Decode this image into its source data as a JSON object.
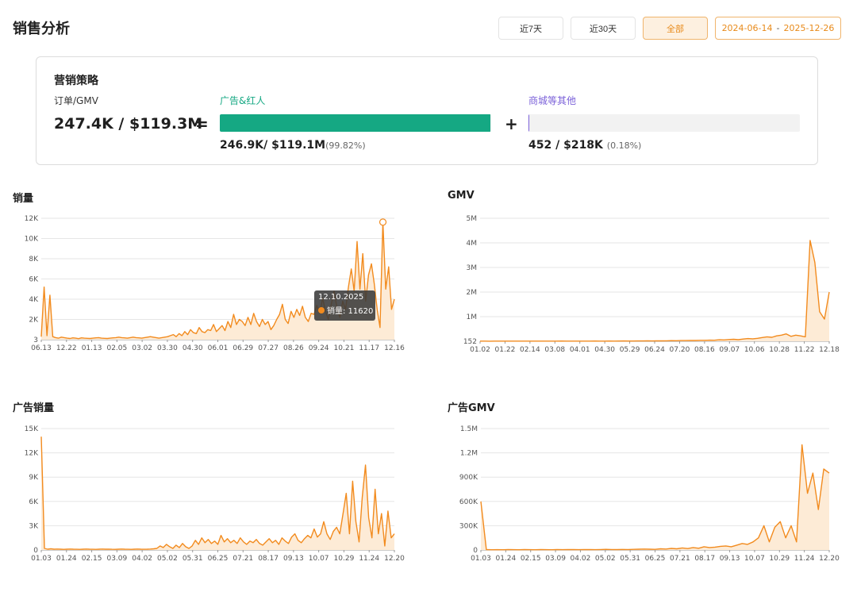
{
  "page": {
    "title": "销售分析"
  },
  "filters": {
    "btn7": "近7天",
    "btn30": "近30天",
    "all": "全部",
    "date_start": "2024-06-14",
    "date_sep": "-",
    "date_end": "2025-12-26"
  },
  "strategy": {
    "title": "营销策略",
    "label": "订单/GMV",
    "total": "247.4K / $119.3M",
    "equals": "=",
    "plus": "+",
    "ad": {
      "label": "广告&红人",
      "value": "246.9K/ $119.1M",
      "pct": "(99.82%)",
      "share": 99.82,
      "color": "#15a883"
    },
    "other": {
      "label": "商城等其他",
      "value": "452 / $218K",
      "pct": "(0.18%)",
      "share": 0.18,
      "color": "#7b61d9"
    }
  },
  "colors": {
    "line": "#f28b1e",
    "area": "#fdebd6",
    "grid": "#e6e6e6",
    "axis": "#555555"
  },
  "charts": {
    "sales": {
      "title": "销量"
    },
    "gmv": {
      "title": "GMV"
    },
    "ad_sales": {
      "title": "广告销量"
    },
    "ad_gmv": {
      "title": "广告GMV"
    }
  },
  "tooltip": {
    "date": "12.10.2025",
    "label": "销量: 11620"
  },
  "chart_data": [
    {
      "type": "area",
      "title": "销量",
      "x_ticks": [
        "06.13",
        "12.22",
        "01.13",
        "02.05",
        "03.02",
        "03.30",
        "04.30",
        "06.01",
        "06.29",
        "07.27",
        "08.26",
        "09.24",
        "10.21",
        "11.17",
        "12.16"
      ],
      "y_ticks": [
        "3",
        "2K",
        "4K",
        "6K",
        "8K",
        "10K",
        "12K"
      ],
      "ylim": [
        0,
        12000
      ],
      "values": [
        300,
        5200,
        400,
        4400,
        300,
        200,
        150,
        250,
        200,
        150,
        120,
        180,
        150,
        100,
        180,
        150,
        130,
        120,
        150,
        180,
        200,
        150,
        130,
        120,
        150,
        180,
        200,
        250,
        200,
        180,
        150,
        200,
        250,
        200,
        180,
        150,
        200,
        250,
        300,
        250,
        200,
        150,
        200,
        250,
        300,
        400,
        500,
        300,
        600,
        400,
        800,
        500,
        1000,
        700,
        600,
        1200,
        800,
        700,
        1000,
        900,
        1500,
        800,
        1100,
        1400,
        900,
        1800,
        1200,
        2500,
        1500,
        2000,
        1800,
        1400,
        2200,
        1500,
        2600,
        1800,
        1300,
        2000,
        1500,
        1800,
        1000,
        1400,
        2000,
        2500,
        3500,
        2000,
        1600,
        2800,
        2200,
        3000,
        2400,
        3300,
        2200,
        1800,
        2600,
        2500,
        3400,
        2600,
        4100,
        2800,
        2000,
        3500,
        4800,
        3200,
        2200,
        3800,
        3000,
        5200,
        7000,
        4800,
        9700,
        5000,
        8500,
        3800,
        6400,
        7500,
        5500,
        3000,
        1200,
        11620,
        5000,
        7200,
        3000,
        4000
      ],
      "marker_index": 119
    },
    {
      "type": "area",
      "title": "GMV",
      "x_ticks": [
        "01.02",
        "01.22",
        "02.14",
        "03.08",
        "04.01",
        "04.30",
        "05.29",
        "06.24",
        "07.20",
        "08.16",
        "09.07",
        "10.06",
        "10.28",
        "11.22",
        "12.18"
      ],
      "y_ticks": [
        "152",
        "1M",
        "2M",
        "3M",
        "4M",
        "5M"
      ],
      "ylim": [
        0,
        5000000
      ],
      "values": [
        5000,
        6000,
        4000,
        5000,
        6000,
        7000,
        5000,
        8000,
        6000,
        5000,
        7000,
        6000,
        5000,
        8000,
        7000,
        6000,
        5000,
        9000,
        7000,
        6000,
        8000,
        5000,
        7000,
        6000,
        9000,
        8000,
        7000,
        10000,
        8000,
        9000,
        12000,
        10000,
        9000,
        14000,
        12000,
        15000,
        13000,
        18000,
        16000,
        20000,
        25000,
        22000,
        30000,
        28000,
        35000,
        32000,
        40000,
        38000,
        45000,
        42000,
        60000,
        55000,
        70000,
        80000,
        65000,
        90000,
        110000,
        100000,
        120000,
        150000,
        180000,
        160000,
        220000,
        250000,
        300000,
        200000,
        250000,
        220000,
        180000,
        4100000,
        3200000,
        1200000,
        900000,
        2000000
      ]
    },
    {
      "type": "area",
      "title": "广告销量",
      "x_ticks": [
        "01.03",
        "01.24",
        "02.15",
        "03.09",
        "04.02",
        "05.02",
        "05.31",
        "06.25",
        "07.21",
        "08.17",
        "09.13",
        "10.07",
        "10.29",
        "11.24",
        "12.20"
      ],
      "y_ticks": [
        "0",
        "3K",
        "6K",
        "9K",
        "12K",
        "15K"
      ],
      "ylim": [
        0,
        15000
      ],
      "values": [
        14000,
        200,
        100,
        150,
        100,
        120,
        100,
        80,
        100,
        120,
        100,
        90,
        80,
        100,
        120,
        100,
        90,
        80,
        100,
        120,
        100,
        110,
        90,
        80,
        100,
        120,
        100,
        90,
        80,
        100,
        120,
        100,
        90,
        100,
        120,
        150,
        200,
        500,
        300,
        700,
        400,
        200,
        600,
        300,
        800,
        400,
        200,
        500,
        1200,
        700,
        1500,
        900,
        1300,
        800,
        1100,
        700,
        1800,
        1000,
        1400,
        900,
        1200,
        800,
        1500,
        1000,
        700,
        1100,
        900,
        1300,
        800,
        600,
        1000,
        1400,
        900,
        1200,
        700,
        1500,
        1100,
        800,
        1600,
        2000,
        1200,
        900,
        1400,
        1800,
        1500,
        2600,
        1600,
        2000,
        3500,
        2000,
        1300,
        2300,
        2800,
        2000,
        4500,
        7000,
        2000,
        8500,
        3500,
        1000,
        6500,
        10500,
        4000,
        1500,
        7500,
        2000,
        4500,
        500,
        4800,
        1500,
        2000
      ]
    },
    {
      "type": "area",
      "title": "广告GMV",
      "x_ticks": [
        "01.03",
        "01.24",
        "02.15",
        "03.09",
        "04.02",
        "05.02",
        "05.31",
        "06.25",
        "07.21",
        "08.17",
        "09.13",
        "10.07",
        "10.29",
        "11.24",
        "12.20"
      ],
      "y_ticks": [
        "0",
        "300K",
        "600K",
        "900K",
        "1.2M",
        "1.5M"
      ],
      "ylim": [
        0,
        1500000
      ],
      "values": [
        600000,
        5000,
        3000,
        4000,
        3000,
        5000,
        4000,
        3000,
        5000,
        4000,
        3000,
        5000,
        4000,
        3000,
        5000,
        4000,
        6000,
        5000,
        4000,
        6000,
        5000,
        4000,
        6000,
        8000,
        6000,
        5000,
        7000,
        6000,
        8000,
        10000,
        12000,
        10000,
        8000,
        15000,
        12000,
        20000,
        15000,
        25000,
        18000,
        30000,
        22000,
        40000,
        30000,
        35000,
        45000,
        50000,
        40000,
        60000,
        80000,
        70000,
        100000,
        150000,
        300000,
        100000,
        280000,
        350000,
        150000,
        300000,
        100000,
        1300000,
        700000,
        950000,
        500000,
        1000000,
        950000
      ]
    }
  ]
}
